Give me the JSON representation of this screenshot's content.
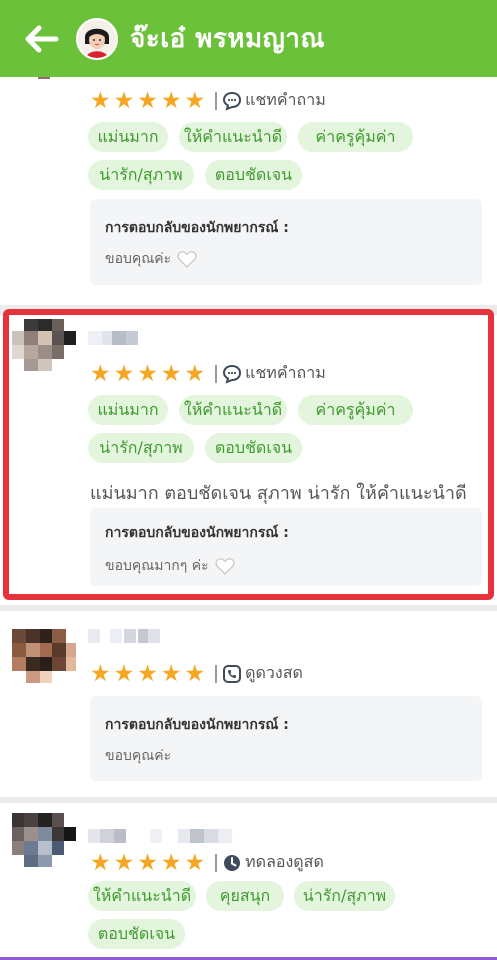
{
  "header": {
    "title": "จ๊ะเอ๋ พรหมญาณ",
    "bg_color": "#6cc13a"
  },
  "reply_heading": "การตอบกลับของนักพยากรณ์ :",
  "star_color": "#f5a623",
  "highlight_color": "#e6333b",
  "reviews": [
    {
      "rating": 5,
      "service_icon": "chat-bubble-icon",
      "service": "แชทคำถาม",
      "tags": [
        "แม่นมาก",
        "ให้คำแนะนำดี",
        "ค่าครูคุ้มค่า",
        "น่ารัก/สุภาพ",
        "ตอบชัดเจน"
      ],
      "reply": "ขอบคุณค่ะ",
      "reply_heart": true
    },
    {
      "rating": 5,
      "service_icon": "chat-bubble-icon",
      "service": "แชทคำถาม",
      "tags": [
        "แม่นมาก",
        "ให้คำแนะนำดี",
        "ค่าครูคุ้มค่า",
        "น่ารัก/สุภาพ",
        "ตอบชัดเจน"
      ],
      "comment": "แม่นมาก ตอบชัดเจน สุภาพ น่ารัก ให้คำแนะนำดี",
      "reply": "ขอบคุณมากๆ ค่ะ",
      "reply_heart": true,
      "highlighted": true
    },
    {
      "rating": 5,
      "service_icon": "phone-icon",
      "service": "ดูดวงสด",
      "tags": [],
      "reply": "ขอบคุณค่ะ",
      "reply_heart": false
    },
    {
      "rating": 5,
      "service_icon": "clock-icon",
      "service": "ทดลองดูสด",
      "tags": [
        "ให้คำแนะนำดี",
        "คุยสนุก",
        "น่ารัก/สุภาพ",
        "ตอบชัดเจน"
      ]
    }
  ]
}
